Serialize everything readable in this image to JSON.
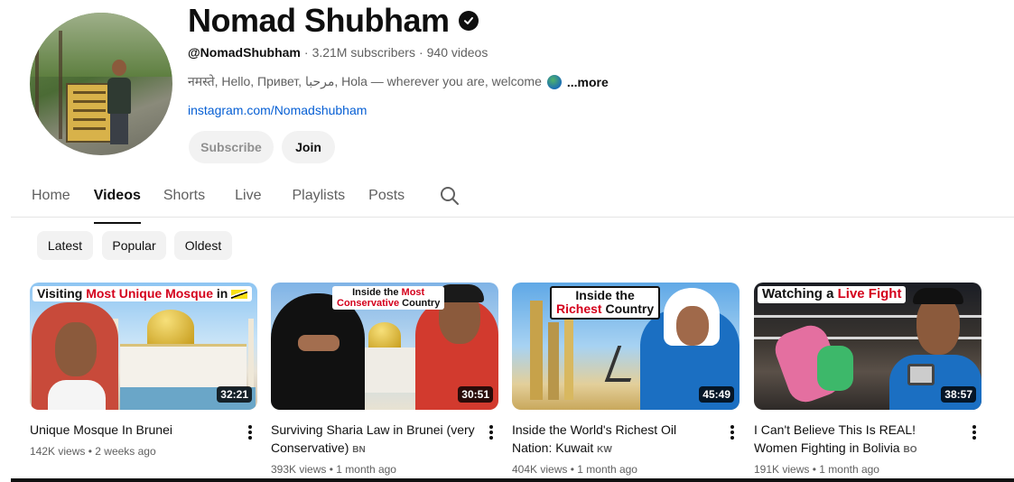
{
  "channel": {
    "name": "Nomad Shubham",
    "handle": "@NomadShubham",
    "subscribers": "3.21M subscribers",
    "videos_count": "940 videos",
    "description": "नमस्ते, Hello, Привет, مرحبا, Hola — wherever you are, welcome",
    "more_label": "...more",
    "link": "instagram.com/Nomadshubham",
    "subscribe_label": "Subscribe",
    "join_label": "Join"
  },
  "tabs": [
    {
      "label": "Home"
    },
    {
      "label": "Videos"
    },
    {
      "label": "Shorts"
    },
    {
      "label": "Live"
    },
    {
      "label": "Playlists"
    },
    {
      "label": "Posts"
    }
  ],
  "active_tab": "Videos",
  "chips": [
    {
      "label": "Latest"
    },
    {
      "label": "Popular"
    },
    {
      "label": "Oldest"
    }
  ],
  "videos": [
    {
      "title": "Unique Mosque In Brunei",
      "country_code": "",
      "views": "142K views",
      "age": "2 weeks ago",
      "duration": "32:21",
      "thumb_text_a": "Visiting ",
      "thumb_text_b": "Most Unique Mosque",
      "thumb_text_c": " in"
    },
    {
      "title": "Surviving Sharia Law in Brunei (very Conservative)",
      "country_code": "BN",
      "views": "393K views",
      "age": "1 month ago",
      "duration": "30:51",
      "thumb_text_a": "Inside the ",
      "thumb_text_b": "Most",
      "thumb_text_c": "Conservative",
      "thumb_text_d": " Country"
    },
    {
      "title": "Inside the World's Richest Oil Nation: Kuwait",
      "country_code": "KW",
      "views": "404K views",
      "age": "1 month ago",
      "duration": "45:49",
      "thumb_text_a": "Inside the",
      "thumb_text_b": "Richest",
      "thumb_text_c": " Country"
    },
    {
      "title": "I Can't Believe This Is REAL! Women Fighting in Bolivia",
      "country_code": "BO",
      "views": "191K views",
      "age": "1 month ago",
      "duration": "38:57",
      "thumb_text_a": "Watching a ",
      "thumb_text_b": "Live Fight"
    }
  ],
  "separator": "·",
  "bullet": "•"
}
